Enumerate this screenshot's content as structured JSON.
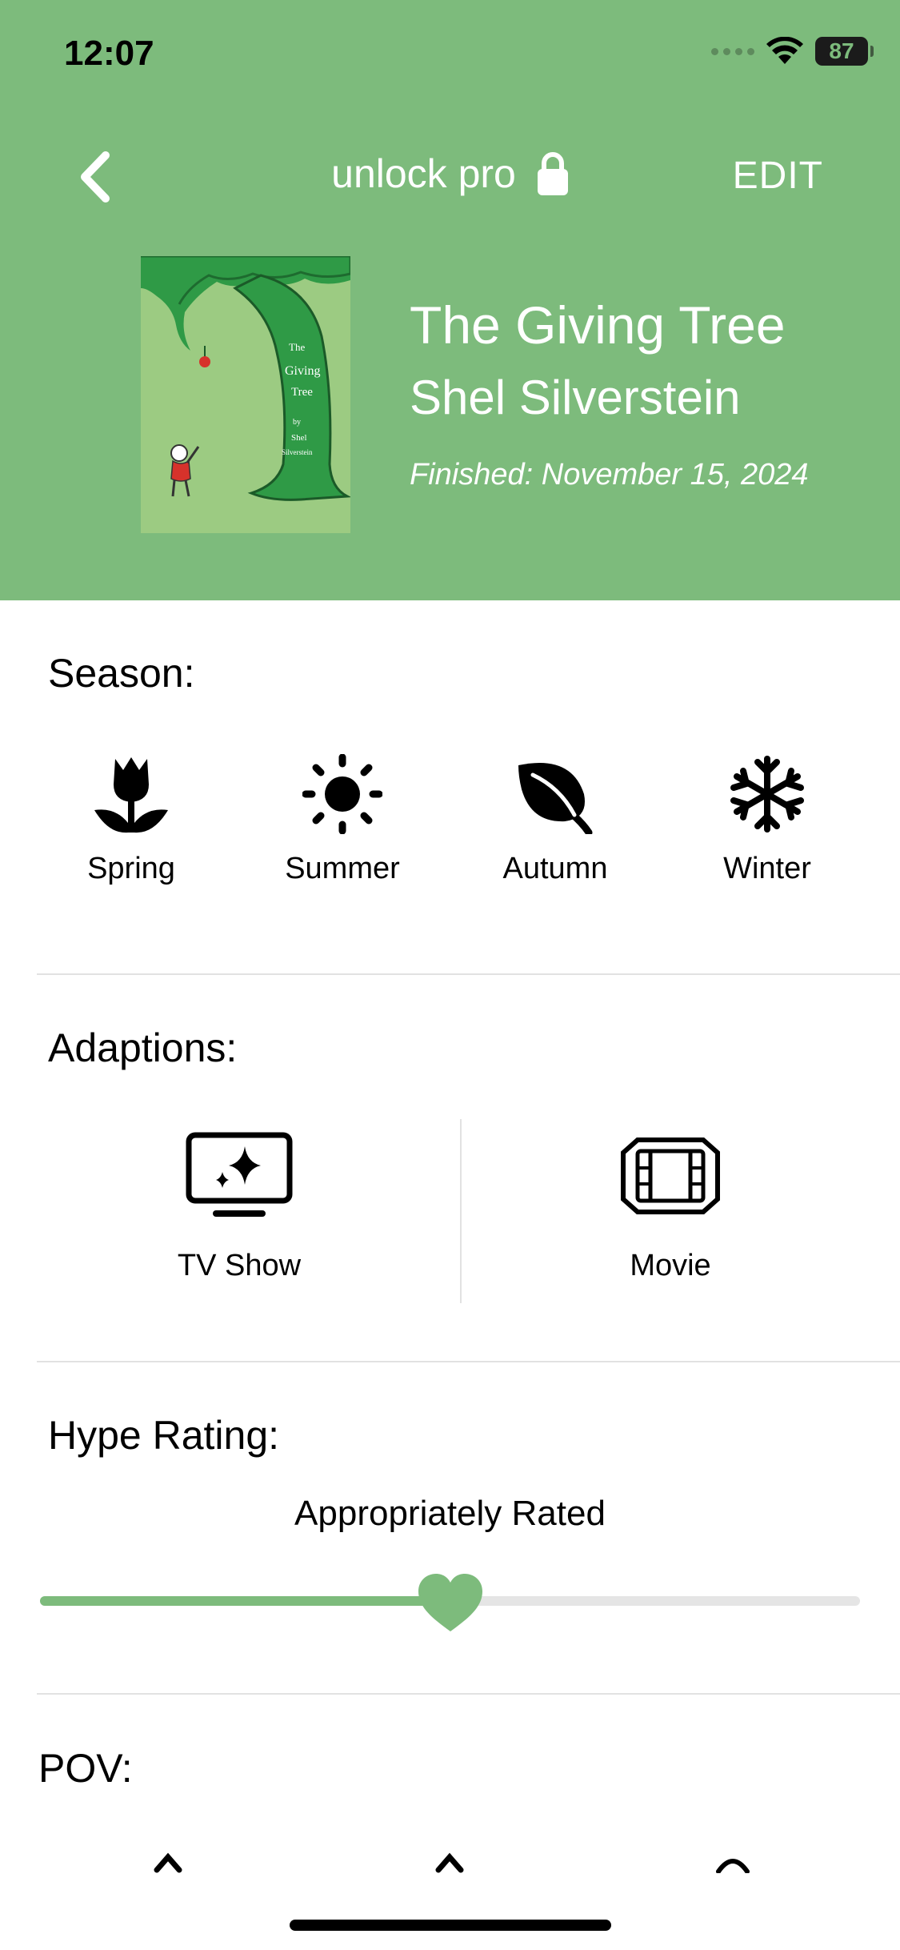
{
  "status_bar": {
    "time": "12:07",
    "battery": "87"
  },
  "nav": {
    "title": "unlock pro",
    "edit_label": "EDIT",
    "back_icon": "chevron-left-icon",
    "lock_icon": "lock-icon"
  },
  "book": {
    "title": "The Giving Tree",
    "author": "Shel Silverstein",
    "finished": "Finished: November 15, 2024",
    "cover_text": [
      "The",
      "Giving",
      "Tree",
      "by",
      "Shel",
      "Silverstein"
    ]
  },
  "season": {
    "label": "Season:",
    "options": [
      {
        "label": "Spring",
        "icon": "tulip-icon"
      },
      {
        "label": "Summer",
        "icon": "sun-icon"
      },
      {
        "label": "Autumn",
        "icon": "leaf-icon"
      },
      {
        "label": "Winter",
        "icon": "snowflake-icon"
      }
    ]
  },
  "adaptions": {
    "label": "Adaptions:",
    "options": [
      {
        "label": "TV Show",
        "icon": "tv-sparkle-icon"
      },
      {
        "label": "Movie",
        "icon": "film-icon"
      }
    ]
  },
  "hype": {
    "label": "Hype Rating:",
    "value_text": "Appropriately Rated",
    "value": 0.5
  },
  "pov": {
    "label": "POV:"
  },
  "colors": {
    "accent": "#7DBB7C",
    "divider": "#e2e2e2",
    "track": "#e5e5e5"
  }
}
